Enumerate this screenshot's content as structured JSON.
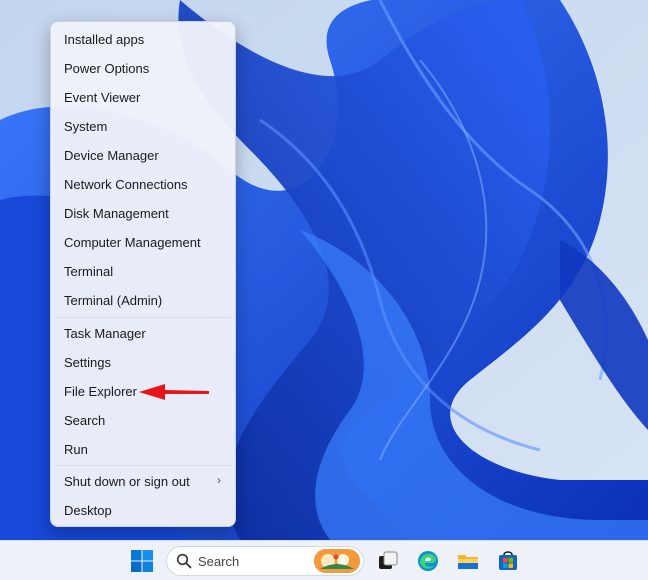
{
  "context_menu": {
    "group1": [
      {
        "label": "Installed apps"
      },
      {
        "label": "Power Options"
      },
      {
        "label": "Event Viewer"
      },
      {
        "label": "System"
      },
      {
        "label": "Device Manager"
      },
      {
        "label": "Network Connections"
      },
      {
        "label": "Disk Management"
      },
      {
        "label": "Computer Management"
      },
      {
        "label": "Terminal"
      },
      {
        "label": "Terminal (Admin)"
      }
    ],
    "group2": [
      {
        "label": "Task Manager"
      },
      {
        "label": "Settings"
      },
      {
        "label": "File Explorer"
      },
      {
        "label": "Search"
      },
      {
        "label": "Run"
      }
    ],
    "group3": [
      {
        "label": "Shut down or sign out",
        "submenu": true
      },
      {
        "label": "Desktop"
      }
    ],
    "submenu_chevron": "›"
  },
  "annotation": {
    "arrow_color": "#e8141c",
    "points_to": "File Explorer"
  },
  "taskbar": {
    "search_label": "Search",
    "icons": [
      "windows-start-icon",
      "search-icon",
      "task-view-icon",
      "edge-icon",
      "file-explorer-icon",
      "microsoft-store-icon"
    ]
  },
  "colors": {
    "accent": "#0067c0",
    "wallpaper_blue": "#1d4fe0"
  }
}
